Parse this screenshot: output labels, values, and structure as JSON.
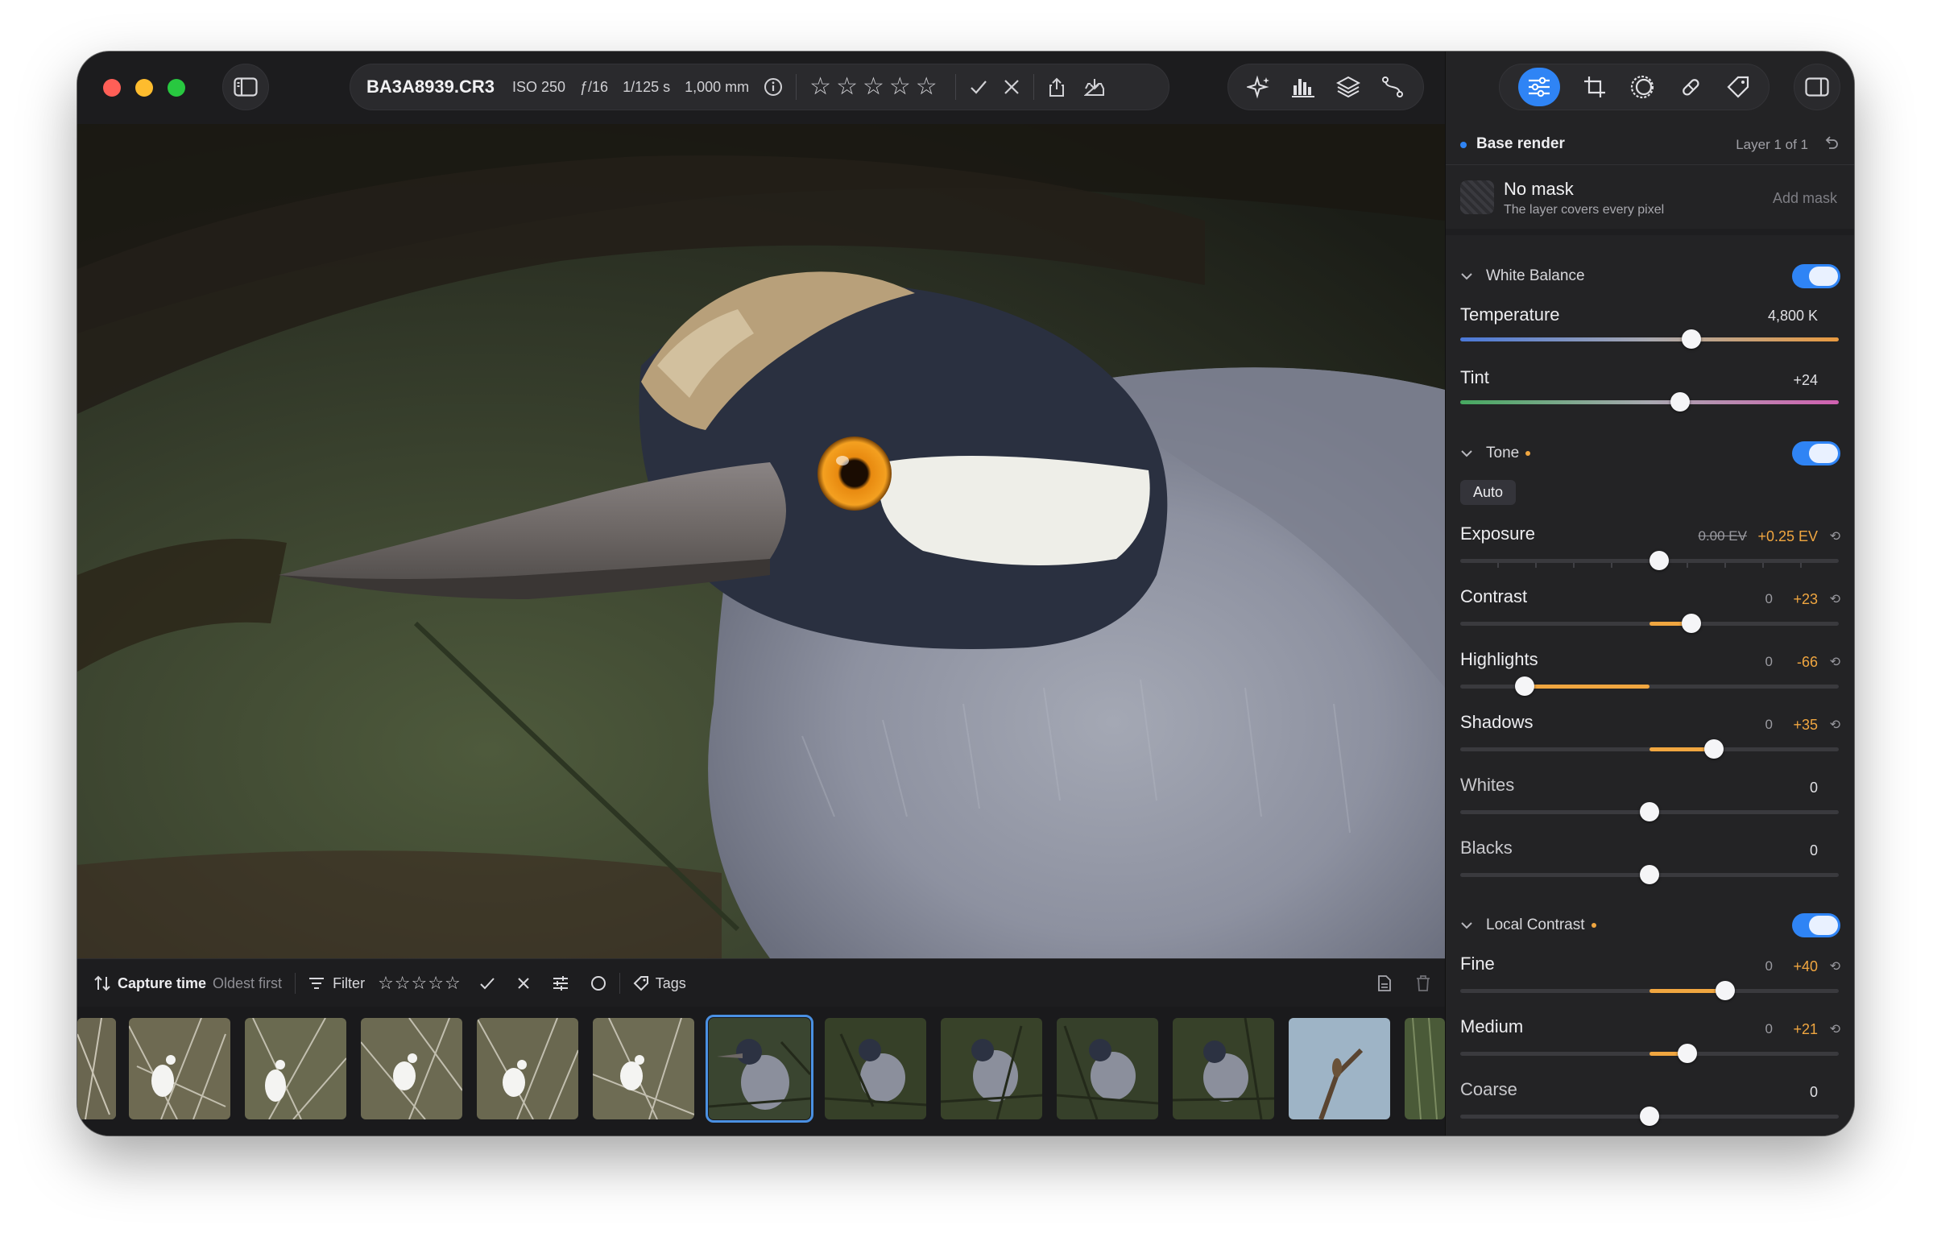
{
  "file": {
    "name": "BA3A8939.CR3",
    "iso": "ISO 250",
    "aperture": "ƒ/16",
    "shutter": "1/125 s",
    "focal": "1,000 mm"
  },
  "rating_stars": [
    "☆",
    "☆",
    "☆",
    "☆",
    "☆"
  ],
  "filter_bar": {
    "sort_label": "Capture time",
    "sort_order": "Oldest first",
    "filter_label": "Filter",
    "tags_label": "Tags"
  },
  "panel": {
    "layer_name": "Base render",
    "layer_count": "Layer 1 of 1",
    "mask_title": "No mask",
    "mask_subtitle": "The layer covers every pixel",
    "add_mask": "Add mask",
    "white_balance": {
      "title": "White Balance",
      "enabled": true,
      "temperature": {
        "label": "Temperature",
        "value": "4,800 K",
        "position": 0.61
      },
      "tint": {
        "label": "Tint",
        "value": "+24",
        "position": 0.58
      }
    },
    "tone": {
      "title": "Tone",
      "enabled": true,
      "auto_label": "Auto",
      "exposure": {
        "label": "Exposure",
        "old_value": "0.00 EV",
        "value": "+0.25 EV",
        "position": 0.525
      },
      "contrast": {
        "label": "Contrast",
        "zero": "0",
        "value": "+23",
        "position": 0.61
      },
      "highlights": {
        "label": "Highlights",
        "zero": "0",
        "value": "-66",
        "position": 0.17
      },
      "shadows": {
        "label": "Shadows",
        "zero": "0",
        "value": "+35",
        "position": 0.67
      },
      "whites": {
        "label": "Whites",
        "value": "0",
        "position": 0.5
      },
      "blacks": {
        "label": "Blacks",
        "value": "0",
        "position": 0.5
      }
    },
    "local_contrast": {
      "title": "Local Contrast",
      "enabled": true,
      "fine": {
        "label": "Fine",
        "zero": "0",
        "value": "+40",
        "position": 0.7
      },
      "medium": {
        "label": "Medium",
        "zero": "0",
        "value": "+21",
        "position": 0.6
      },
      "coarse": {
        "label": "Coarse",
        "value": "0",
        "position": 0.5
      }
    }
  },
  "colors": {
    "accent": "#2f84f5",
    "adjusted": "#f0a640",
    "panel_bg": "#232325"
  }
}
